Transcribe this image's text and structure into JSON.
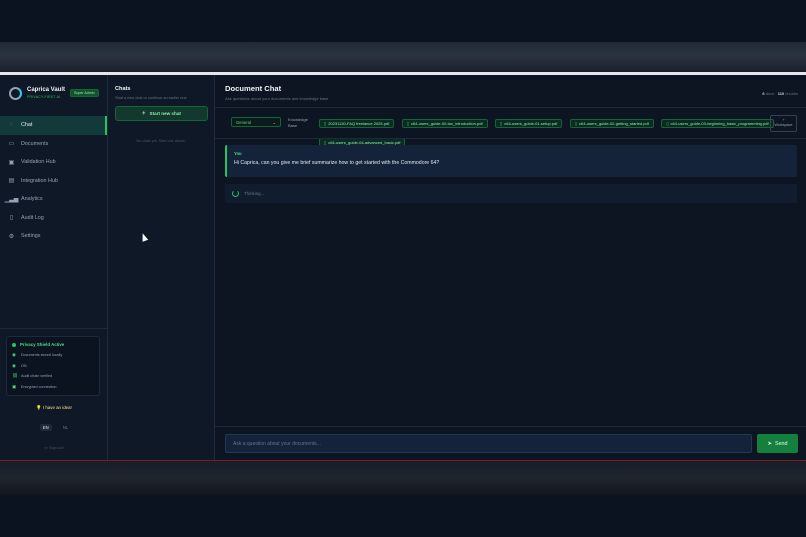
{
  "brand": {
    "name": "Caprica Vault",
    "tagline": "PRIVACY-FIRST AI",
    "role_badge": "Super Admin"
  },
  "nav": {
    "items": [
      {
        "label": "Chat",
        "icon": "chat-icon",
        "active": true
      },
      {
        "label": "Documents",
        "icon": "document-icon",
        "active": false
      },
      {
        "label": "Validation Hub",
        "icon": "validation-icon",
        "active": false
      },
      {
        "label": "Integration Hub",
        "icon": "integration-icon",
        "active": false
      },
      {
        "label": "Analytics",
        "icon": "analytics-icon",
        "active": false
      },
      {
        "label": "Audit Log",
        "icon": "audit-icon",
        "active": false
      },
      {
        "label": "Settings",
        "icon": "settings-icon",
        "active": false
      }
    ]
  },
  "privacy": {
    "title": "Privacy Shield Active",
    "rows": [
      "Documents stored locally",
      "ON",
      "Audit chain verified",
      "Encrypted connection"
    ]
  },
  "idea_label": "I have an idea!",
  "lang": {
    "current": "EN",
    "other": "NL"
  },
  "signout_label": "Sign out",
  "chats": {
    "title": "Chats",
    "subtitle": "Start a new chat or continue an earlier one",
    "new_chat_label": "Start new chat",
    "empty_label": "No chats yet. Start one above."
  },
  "main": {
    "title": "Document Chat",
    "subtitle": "Ask questions about your documents and knowledge base",
    "stats": {
      "docs_count": "6",
      "docs_label": "docs",
      "chunks_count": "110",
      "chunks_label": "chunks"
    },
    "kb_select": "General",
    "kb_label": "Knowledge Base",
    "documents": [
      "20231130-FAQ freelance 2025.pdf",
      "c64-users_guide-00-toc_introduction.pdf",
      "c64-users_guide-01-setup.pdf",
      "c64-users_guide-02-getting_started.pdf",
      "c64-users_guide-03-beginning_basic_programming.pdf",
      "c64-users_guide-04-advanced_basic.pdf"
    ],
    "workspace_label": "Workspace",
    "messages": {
      "user_from": "You",
      "user_text": "Hi Caprica, can you give me brief summarize how to get started with the Commodore 64?",
      "thinking": "Thinking..."
    },
    "input_placeholder": "Ask a question about your documents...",
    "send_label": "Send"
  },
  "colors": {
    "accent": "#22c55e",
    "background": "#0d1522",
    "panel": "#0f1826"
  }
}
